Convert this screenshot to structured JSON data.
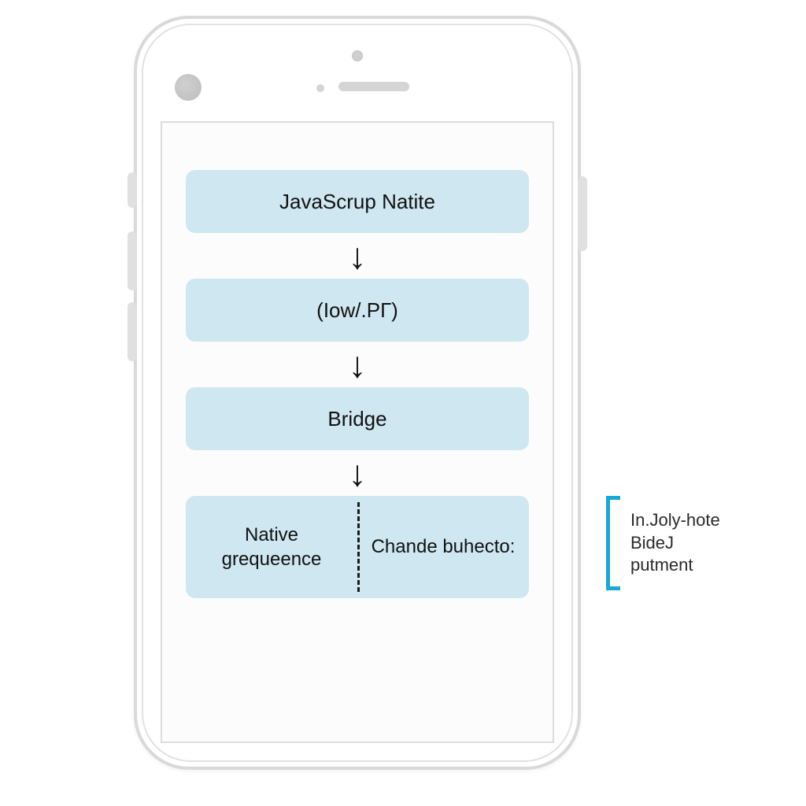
{
  "flow": {
    "nodes": [
      {
        "label": "JavaScrup Natite"
      },
      {
        "label": "(Iow/.PГ)"
      },
      {
        "label": "Bridge"
      }
    ],
    "split": {
      "left": "Native grequeence",
      "right": "Chande buhecto:"
    }
  },
  "annotation": {
    "line1": "In.Joly-hote",
    "line2": "BideJ",
    "line3": "putment"
  },
  "colors": {
    "node_bg": "#cfe7f0",
    "bracket": "#17a7d8"
  }
}
